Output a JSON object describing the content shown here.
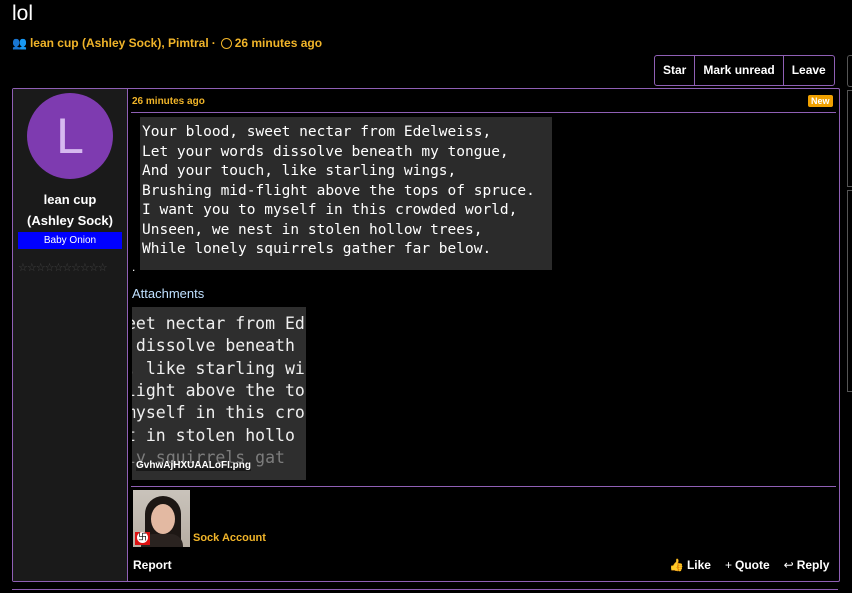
{
  "thread": {
    "title": "lol",
    "participants": "lean cup (Ashley Sock), Pimtral",
    "separator": "·",
    "age": "26 minutes ago"
  },
  "thread_actions": {
    "star": "Star",
    "mark_unread": "Mark unread",
    "leave": "Leave"
  },
  "post": {
    "time": "26 minutes ago",
    "new_badge": "New",
    "author": {
      "initial": "L",
      "name_line1": "lean cup",
      "name_line2": "(Ashley Sock)",
      "title": "Baby Onion",
      "stars": "☆☆☆☆☆☆☆☆☆☆",
      "avatar_color": "#7e3bb0",
      "badge_color": "#0000ff"
    },
    "poem": [
      "Your blood, sweet nectar from Edelweiss,",
      "Let your words dissolve beneath my tongue,",
      "And your touch, like starling wings,",
      "Brushing mid-flight above the tops of spruce.",
      "I want you to myself in this crowded world,",
      "Unseen, we nest in stolen hollow trees,",
      "While lonely squirrels gather far below."
    ],
    "trailing_dot": ".",
    "attachments_label": "Attachments",
    "attachment": {
      "filename": "GvhwAjHXUAALoFI.png",
      "preview_lines": [
        "eet nectar from Ed",
        " dissolve beneath",
        ", like starling wi",
        "light above the to",
        "myself in this cro",
        "t in stolen hollo",
        "ly squirrels gat"
      ]
    },
    "signature": {
      "text": "Sock Account"
    },
    "report": "Report",
    "like": "Like",
    "quote": "Quote",
    "reply": "Reply"
  },
  "colors": {
    "accent": "#f0b429",
    "border": "#8f5fb5",
    "link": "#bfe0ff"
  }
}
